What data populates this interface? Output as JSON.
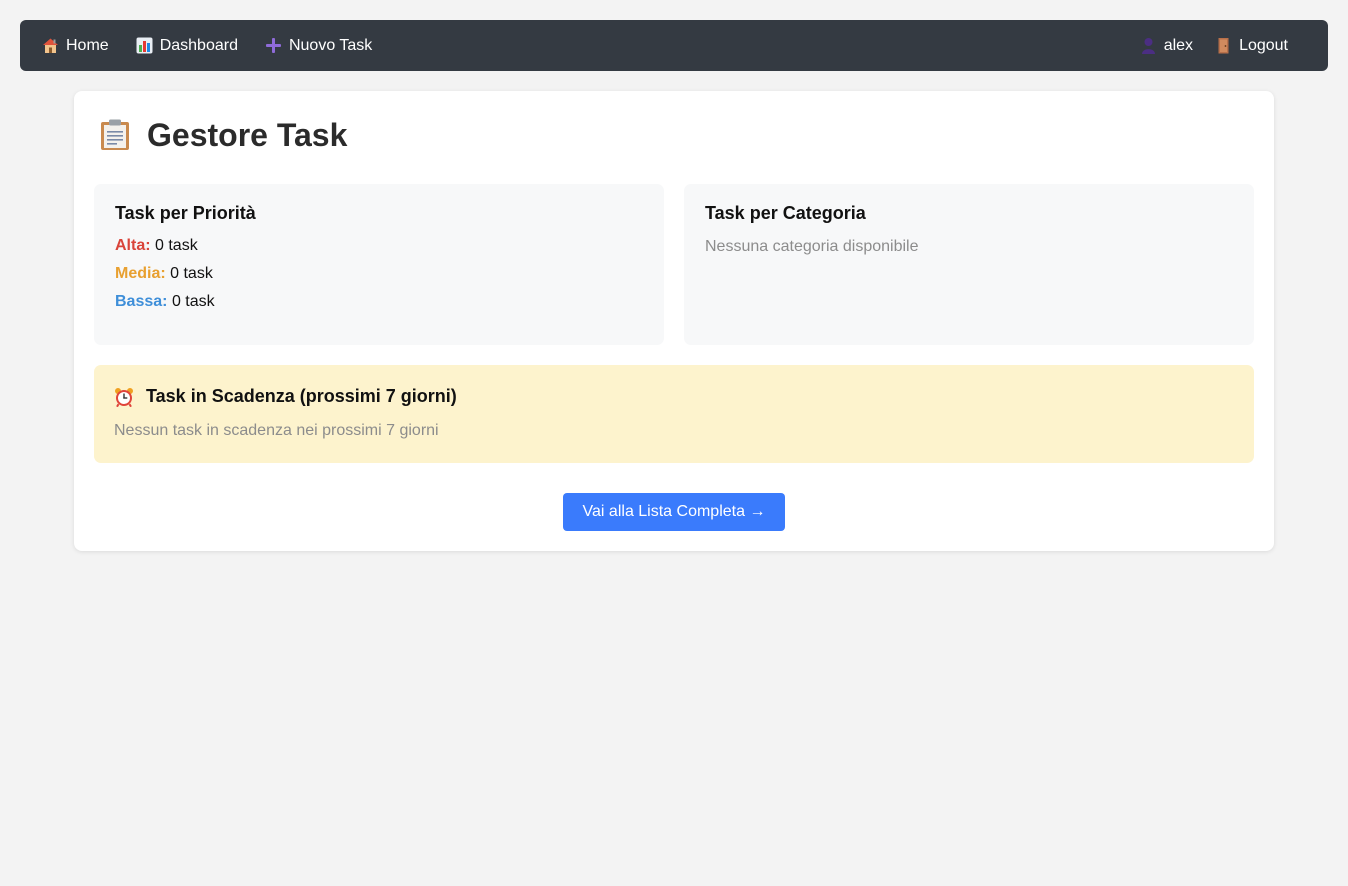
{
  "nav": {
    "left": [
      {
        "label": "Home",
        "icon": "home-icon"
      },
      {
        "label": "Dashboard",
        "icon": "chart-icon"
      },
      {
        "label": "Nuovo Task",
        "icon": "plus-icon"
      }
    ],
    "right": [
      {
        "label": "alex",
        "icon": "user-icon"
      },
      {
        "label": "Logout",
        "icon": "door-icon"
      }
    ]
  },
  "page": {
    "title": "Gestore Task",
    "title_icon": "clipboard-icon"
  },
  "priority_panel": {
    "title": "Task per Priorità",
    "items": [
      {
        "label": "Alta:",
        "value": "0 task",
        "color": "#d9443a"
      },
      {
        "label": "Media:",
        "value": "0 task",
        "color": "#e8a030"
      },
      {
        "label": "Bassa:",
        "value": "0 task",
        "color": "#3f8fd9"
      }
    ]
  },
  "category_panel": {
    "title": "Task per Categoria",
    "empty_text": "Nessuna categoria disponibile"
  },
  "deadline_panel": {
    "title": "Task in Scadenza (prossimi 7 giorni)",
    "icon": "alarm-clock-icon",
    "empty_text": "Nessun task in scadenza nei prossimi 7 giorni"
  },
  "actions": {
    "full_list_button": "Vai alla Lista Completa →"
  },
  "colors": {
    "navbar_bg": "#343a42",
    "accent": "#3a7bfc",
    "deadline_bg": "#fdf3cd"
  }
}
